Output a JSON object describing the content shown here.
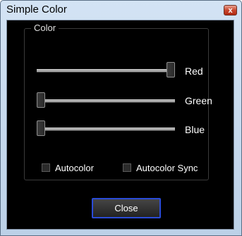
{
  "window": {
    "title": "Simple Color",
    "close_glyph": "x"
  },
  "group": {
    "label": "Color"
  },
  "sliders": [
    {
      "label": "Red",
      "value": 1.0
    },
    {
      "label": "Green",
      "value": 0.0
    },
    {
      "label": "Blue",
      "value": 0.0
    }
  ],
  "checkboxes": [
    {
      "label": "Autocolor",
      "checked": false
    },
    {
      "label": "Autocolor Sync",
      "checked": false
    }
  ],
  "buttons": {
    "close_label": "Close"
  },
  "colors": {
    "client_bg": "#000000",
    "focus_border": "#2a4bd8",
    "text": "#ffffff"
  }
}
